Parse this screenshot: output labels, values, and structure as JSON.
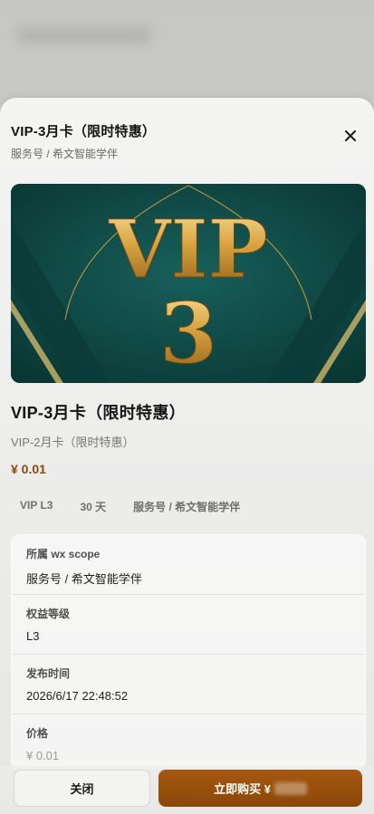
{
  "modal": {
    "title": "VIP-3月卡（限时特惠）",
    "source": "服务号 / 希文智能学伴"
  },
  "banner": {
    "word": "VIP",
    "number": "3",
    "colors": {
      "background": "#0f4a47",
      "gold": "#d9a441"
    }
  },
  "product": {
    "title": "VIP-3月卡（限时特惠）",
    "subtitle": "VIP-2月卡（限时特惠）",
    "price": "¥ 0.01"
  },
  "tags": [
    "VIP L3",
    "30 天",
    "服务号 / 希文智能学伴"
  ],
  "details": [
    {
      "label": "所属 wx scope",
      "value": "服务号 / 希文智能学伴"
    },
    {
      "label": "权益等级",
      "value": "L3"
    },
    {
      "label": "发布时间",
      "value": "2026/6/17 22:48:52"
    },
    {
      "label": "价格",
      "value": "¥ 0.01"
    }
  ],
  "footer": {
    "close_label": "关闭",
    "buy_label": "立即购买 ¥"
  },
  "icons": {
    "close": "close-icon"
  }
}
